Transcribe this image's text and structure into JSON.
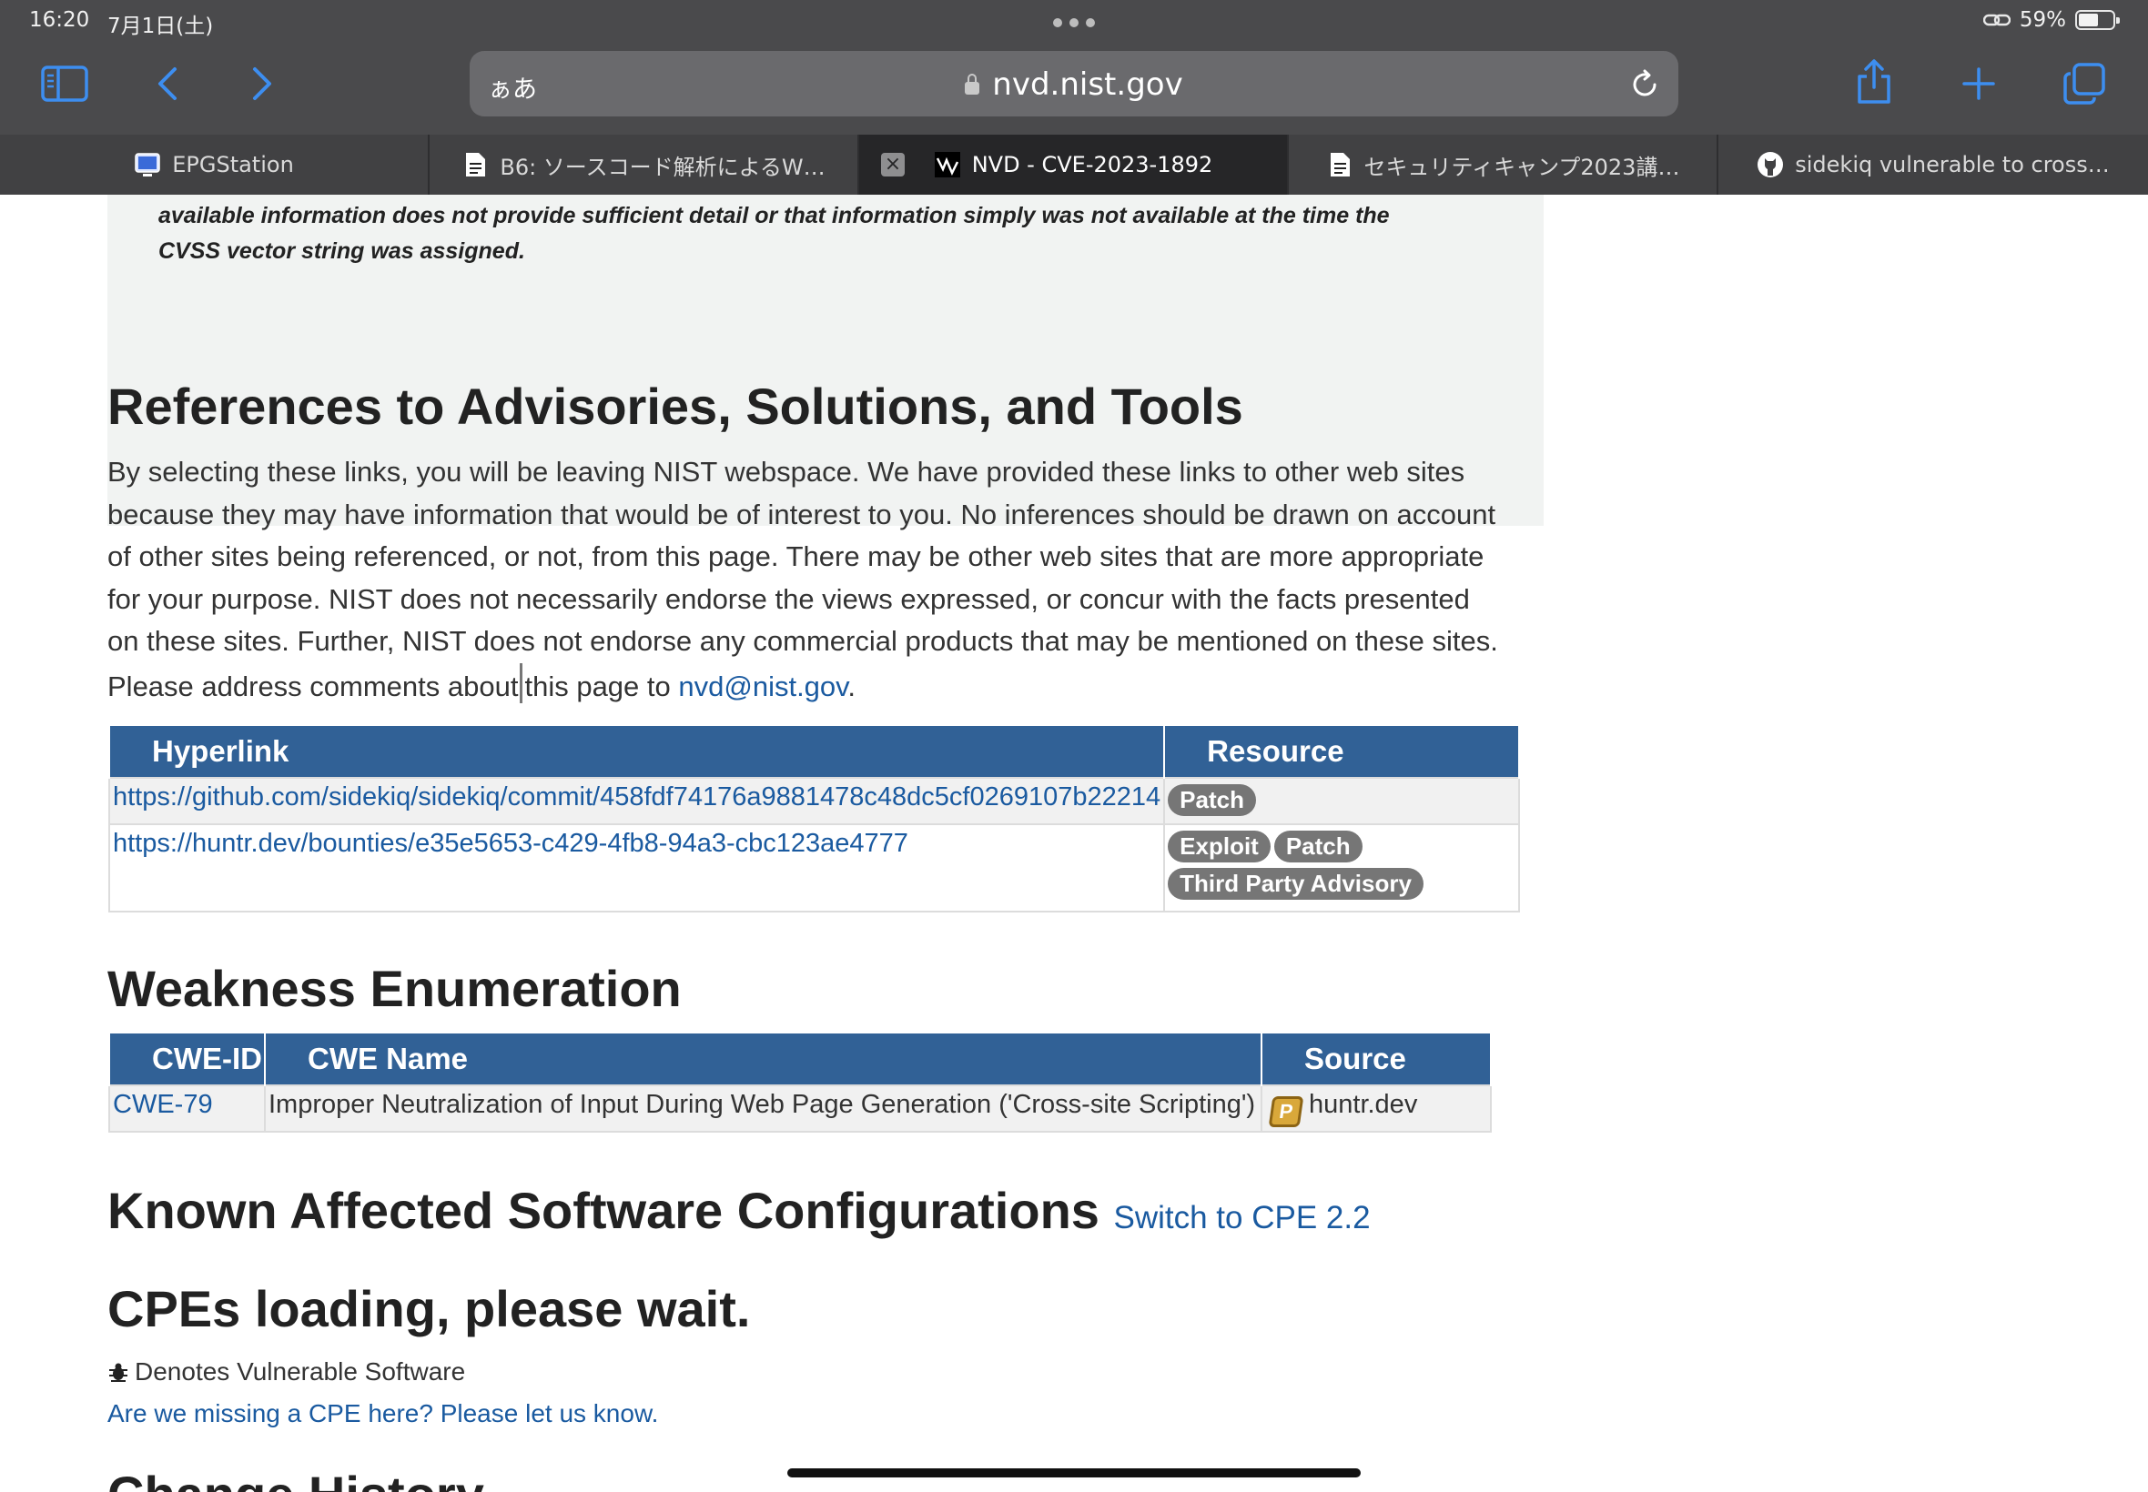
{
  "status": {
    "time": "16:20",
    "date": "7月1日(土)",
    "battery_pct": "59%",
    "battery_level": 0.59
  },
  "browser": {
    "text_size_label": "ぁあ",
    "host": "nvd.nist.gov",
    "tabs": [
      {
        "title": "EPGStation",
        "icon": "tv-app-icon",
        "active": false
      },
      {
        "title": "B6: ソースコード解析によるW…",
        "icon": "document-icon",
        "active": false
      },
      {
        "title": "NVD - CVE-2023-1892",
        "icon": "nvd-icon",
        "active": true
      },
      {
        "title": "セキュリティキャンプ2023講…",
        "icon": "document-icon",
        "active": false
      },
      {
        "title": "sidekiq vulnerable to cross…",
        "icon": "github-icon",
        "active": false
      }
    ]
  },
  "cvss_note": "available information does not provide sufficient detail or that information simply was not available at the time the CVSS vector string was assigned.",
  "references": {
    "heading": "References to Advisories, Solutions, and Tools",
    "disclaimer_before": "By selecting these links, you will be leaving NIST webspace. We have provided these links to other web sites because they may have information that would be of interest to you. No inferences should be drawn on account of other sites being referenced, or not, from this page. There may be other web sites that are more appropriate for your purpose. NIST does not necessarily endorse the views expressed, or concur with the facts presented on these sites. Further, NIST does not endorse any commercial products that may be mentioned on these sites. Please address comments about",
    "disclaimer_middle": "this page to ",
    "contact_email": "nvd@nist.gov",
    "disclaimer_end": ".",
    "col_hyperlink": "Hyperlink",
    "col_resource": "Resource",
    "rows": [
      {
        "url": "https://github.com/sidekiq/sidekiq/commit/458fdf74176a9881478c48dc5cf0269107b22214",
        "tags": [
          "Patch"
        ]
      },
      {
        "url": "https://huntr.dev/bounties/e35e5653-c429-4fb8-94a3-cbc123ae4777",
        "tags": [
          "Exploit",
          "Patch",
          "Third Party Advisory"
        ]
      }
    ]
  },
  "weakness": {
    "heading": "Weakness Enumeration",
    "col_id": "CWE-ID",
    "col_name": "CWE Name",
    "col_source": "Source",
    "row": {
      "id": "CWE-79",
      "name": "Improper Neutralization of Input During Web Page Generation ('Cross-site Scripting')",
      "source_icon_letter": "P",
      "source": "huntr.dev"
    }
  },
  "configs": {
    "heading": "Known Affected Software Configurations",
    "switch_link": "Switch to CPE 2.2",
    "loading": "CPEs loading, please wait.",
    "vuln_note": "Denotes Vulnerable Software",
    "missing_link": "Are we missing a CPE here? Please let us know."
  },
  "next_heading": "Change History",
  "colors": {
    "table_header": "#316196",
    "link": "#1a5aa0",
    "badge": "#767676"
  }
}
